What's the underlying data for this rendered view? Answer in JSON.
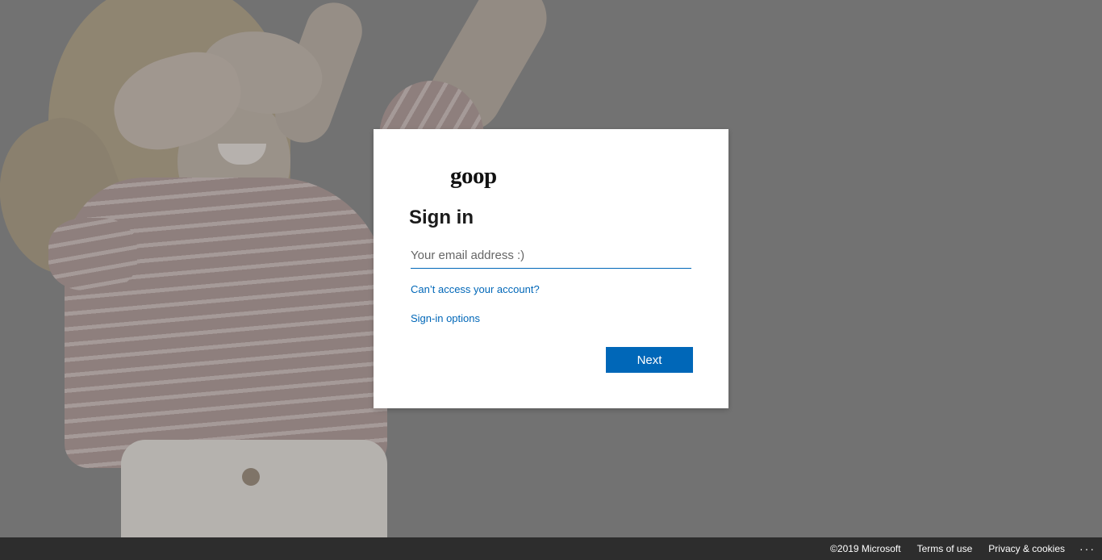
{
  "brand": {
    "logo_text": "goop"
  },
  "signin": {
    "title": "Sign in",
    "email_placeholder": "Your email address :)",
    "email_value": "",
    "cant_access_link": "Can’t access your account?",
    "signin_options_link": "Sign-in options",
    "next_button": "Next"
  },
  "footer": {
    "copyright": "©2019 Microsoft",
    "terms": "Terms of use",
    "privacy": "Privacy & cookies",
    "more": "···"
  },
  "colors": {
    "accent": "#0067b8",
    "background": "#727272",
    "card": "#ffffff",
    "footer_bg": "#333333"
  }
}
